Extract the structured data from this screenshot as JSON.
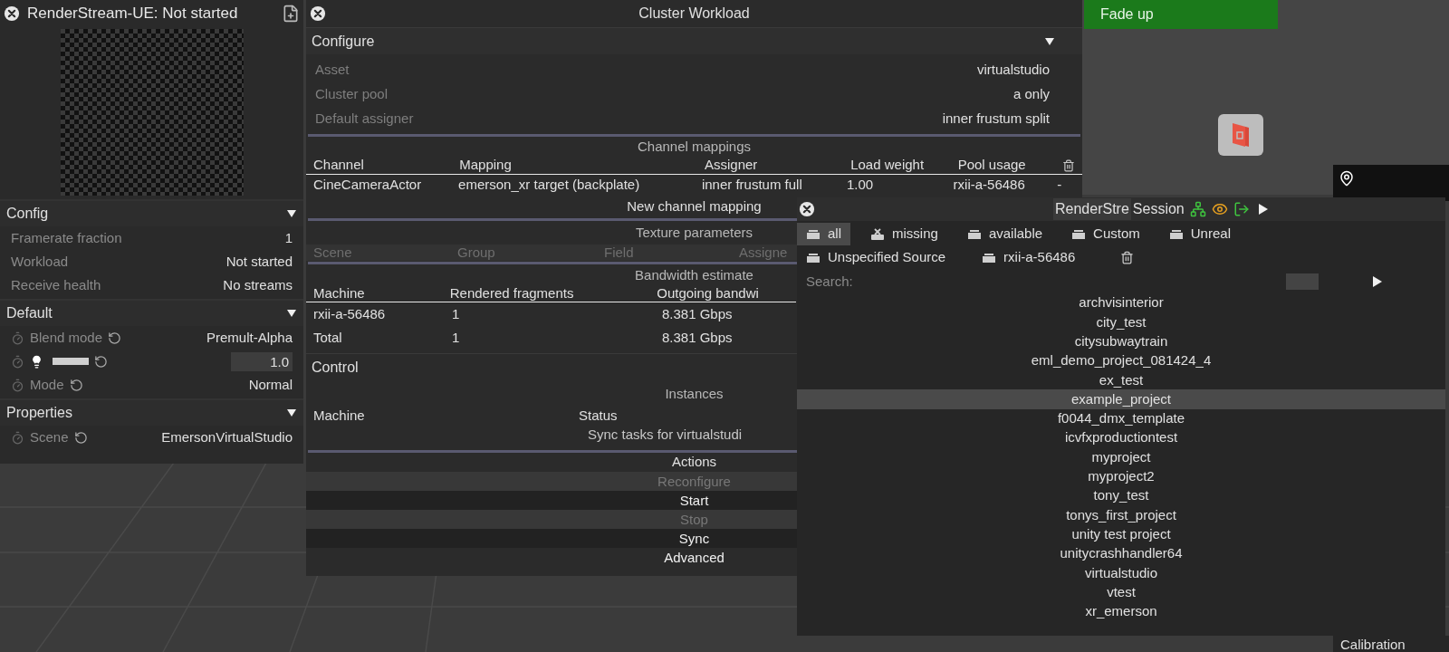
{
  "render_panel": {
    "title": "RenderStream-UE: Not started",
    "sections": [
      {
        "title": "Config",
        "expanded": true,
        "rows": [
          {
            "kind": "text",
            "label": "Framerate fraction",
            "value": "1"
          },
          {
            "kind": "text",
            "label": "Workload",
            "value": "Not started"
          },
          {
            "kind": "text",
            "label": "Receive health",
            "value": "No streams"
          }
        ]
      },
      {
        "title": "Default",
        "expanded": true,
        "rows": [
          {
            "kind": "param",
            "label": "Blend mode",
            "value": "Premult-Alpha"
          },
          {
            "kind": "slider",
            "level": 1,
            "value": "1.0"
          },
          {
            "kind": "param",
            "label": "Mode",
            "value": "Normal"
          }
        ]
      },
      {
        "title": "Properties",
        "expanded": true,
        "rows": [
          {
            "kind": "param",
            "label": "Scene",
            "value": "EmersonVirtualStudio"
          }
        ]
      }
    ]
  },
  "cluster_workload": {
    "title": "Cluster Workload",
    "configure": {
      "title": "Configure",
      "expanded": true,
      "rows": [
        {
          "label": "Asset",
          "value": "virtualstudio"
        },
        {
          "label": "Cluster pool",
          "value": "a only"
        },
        {
          "label": "Default assigner",
          "value": "inner frustum split"
        }
      ]
    },
    "channel_mappings": {
      "title": "Channel mappings",
      "columns": [
        "Channel",
        "Mapping",
        "Assigner",
        "Load weight",
        "Pool usage"
      ],
      "rows": [
        [
          "CineCameraActor",
          "emerson_xr target (backplate)",
          "inner frustum full",
          "1.00",
          "rxii-a-56486",
          "-"
        ]
      ],
      "new_button": "New channel mapping"
    },
    "texture_parameters": {
      "title": "Texture parameters",
      "columns": [
        "Scene",
        "Group",
        "Field",
        "Assigne"
      ]
    },
    "bandwidth": {
      "title": "Bandwidth estimate",
      "columns": [
        "Machine",
        "Rendered fragments",
        "Outgoing bandwi"
      ],
      "rows": [
        [
          "rxii-a-56486",
          "1",
          "8.381 Gbps"
        ],
        [
          "Total",
          "1",
          "8.381 Gbps"
        ]
      ]
    },
    "control": {
      "title": "Control",
      "instances_title": "Instances",
      "columns": [
        "Machine",
        "Status"
      ],
      "sync_tasks": "Sync tasks for virtualstudi"
    },
    "actions": {
      "title": "Actions",
      "buttons": [
        {
          "label": "Reconfigure",
          "disabled": true
        },
        {
          "label": "Start",
          "disabled": false
        },
        {
          "label": "Stop",
          "disabled": true
        },
        {
          "label": "Sync",
          "disabled": false
        },
        {
          "label": "Advanced",
          "disabled": false
        }
      ]
    }
  },
  "fade_button": "Fade up",
  "session": {
    "title": "RenderStre",
    "title_2": "Session",
    "filters": [
      {
        "label": "all",
        "kind": "device",
        "selected": true
      },
      {
        "label": "missing",
        "kind": "missing",
        "selected": false
      },
      {
        "label": "available",
        "kind": "device",
        "selected": false
      },
      {
        "label": "Custom",
        "kind": "device",
        "selected": false
      },
      {
        "label": "Unreal",
        "kind": "device",
        "selected": false
      },
      {
        "label": "Unspecified Source",
        "kind": "device",
        "selected": false
      },
      {
        "label": "rxii-a-56486",
        "kind": "device",
        "selected": false
      }
    ],
    "search_label": "Search:",
    "projects": [
      {
        "name": "archvisinterior",
        "selected": false
      },
      {
        "name": "city_test",
        "selected": false
      },
      {
        "name": "citysubwaytrain",
        "selected": false
      },
      {
        "name": "eml_demo_project_081424_4",
        "selected": false
      },
      {
        "name": "ex_test",
        "selected": false
      },
      {
        "name": "example_project",
        "selected": true
      },
      {
        "name": "f0044_dmx_template",
        "selected": false
      },
      {
        "name": "icvfxproductiontest",
        "selected": false
      },
      {
        "name": "myproject",
        "selected": false
      },
      {
        "name": "myproject2",
        "selected": false
      },
      {
        "name": "tony_test",
        "selected": false
      },
      {
        "name": "tonys_first_project",
        "selected": false
      },
      {
        "name": "unity test project",
        "selected": false
      },
      {
        "name": "unitycrashhandler64",
        "selected": false
      },
      {
        "name": "virtualstudio",
        "selected": false
      },
      {
        "name": "vtest",
        "selected": false
      },
      {
        "name": "xr_emerson",
        "selected": false
      }
    ]
  },
  "calibration_label": "Calibration"
}
